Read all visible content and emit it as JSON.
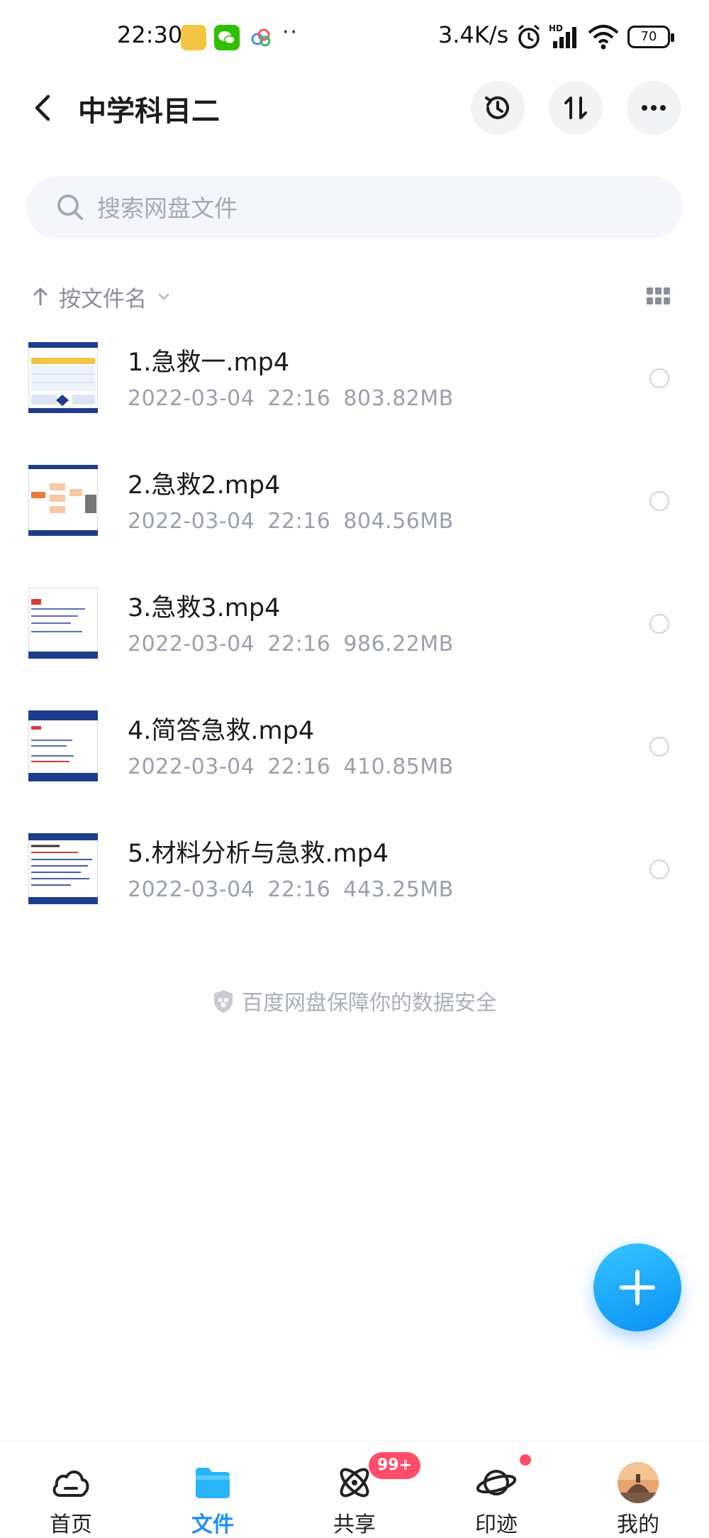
{
  "status_bar": {
    "time": "22:30",
    "dots": "··",
    "network_speed": "3.4K/s",
    "battery": "70",
    "icons": [
      "app-icon",
      "wechat-icon",
      "cloud-app-icon",
      "alarm-icon",
      "signal-icon",
      "wifi-icon",
      "battery-icon"
    ]
  },
  "header": {
    "title": "中学科目二",
    "icons": [
      "back-icon",
      "history-icon",
      "transfer-icon",
      "more-icon"
    ]
  },
  "search": {
    "placeholder": "搜索网盘文件",
    "value": ""
  },
  "sort": {
    "label": "按文件名"
  },
  "files": [
    {
      "name": "1.急救一.mp4",
      "date": "2022-03-04",
      "time": "22:16",
      "size": "803.82MB"
    },
    {
      "name": "2.急救2.mp4",
      "date": "2022-03-04",
      "time": "22:16",
      "size": "804.56MB"
    },
    {
      "name": "3.急救3.mp4",
      "date": "2022-03-04",
      "time": "22:16",
      "size": "986.22MB"
    },
    {
      "name": "4.简答急救.mp4",
      "date": "2022-03-04",
      "time": "22:16",
      "size": "410.85MB"
    },
    {
      "name": "5.材料分析与急救.mp4",
      "date": "2022-03-04",
      "time": "22:16",
      "size": "443.25MB"
    }
  ],
  "footer_note": "百度网盘保障你的数据安全",
  "nav": {
    "items": [
      {
        "label": "首页",
        "icon": "cloud-icon"
      },
      {
        "label": "文件",
        "icon": "folder-icon"
      },
      {
        "label": "共享",
        "icon": "share-orbit-icon"
      },
      {
        "label": "印迹",
        "icon": "planet-icon"
      },
      {
        "label": "我的",
        "icon": "avatar"
      }
    ],
    "active_index": 1,
    "share_badge": "99+"
  },
  "colors": {
    "accent": "#1b8ef6",
    "badge": "#ff4d6a",
    "meta_text": "#9aa0ab"
  }
}
